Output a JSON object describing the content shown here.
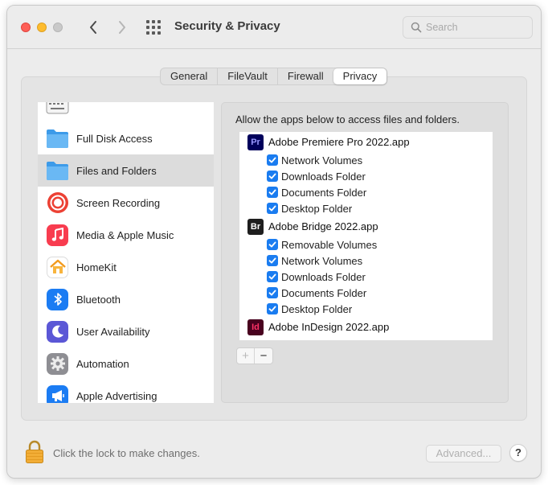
{
  "window": {
    "title": "Security & Privacy",
    "search": {
      "placeholder": "Search",
      "value": ""
    }
  },
  "tabs": [
    {
      "label": "General",
      "active": false
    },
    {
      "label": "FileVault",
      "active": false
    },
    {
      "label": "Firewall",
      "active": false
    },
    {
      "label": "Privacy",
      "active": true
    }
  ],
  "sidebar": {
    "items": [
      {
        "label": "",
        "icon": "keyboard-icon"
      },
      {
        "label": "Full Disk Access",
        "icon": "folder-icon"
      },
      {
        "label": "Files and Folders",
        "icon": "folder-icon",
        "selected": true
      },
      {
        "label": "Screen Recording",
        "icon": "screen-recording-icon"
      },
      {
        "label": "Media & Apple Music",
        "icon": "music-note-icon"
      },
      {
        "label": "HomeKit",
        "icon": "home-icon"
      },
      {
        "label": "Bluetooth",
        "icon": "bluetooth-icon"
      },
      {
        "label": "User Availability",
        "icon": "moon-icon"
      },
      {
        "label": "Automation",
        "icon": "gear-icon"
      },
      {
        "label": "Apple Advertising",
        "icon": "megaphone-icon"
      }
    ]
  },
  "panel": {
    "header": "Allow the apps below to access files and folders.",
    "apps": [
      {
        "name": "Adobe Premiere Pro 2022.app",
        "badge": "Pr",
        "badge_bg": "#00005b",
        "badge_fg": "#9999ff",
        "permissions": [
          {
            "label": "Network Volumes",
            "checked": true
          },
          {
            "label": "Downloads Folder",
            "checked": true
          },
          {
            "label": "Documents Folder",
            "checked": true
          },
          {
            "label": "Desktop Folder",
            "checked": true
          }
        ]
      },
      {
        "name": "Adobe Bridge 2022.app",
        "badge": "Br",
        "badge_bg": "#1e1e1e",
        "badge_fg": "#ffffff",
        "permissions": [
          {
            "label": "Removable Volumes",
            "checked": true
          },
          {
            "label": "Network Volumes",
            "checked": true
          },
          {
            "label": "Downloads Folder",
            "checked": true
          },
          {
            "label": "Documents Folder",
            "checked": true
          },
          {
            "label": "Desktop Folder",
            "checked": true
          }
        ]
      },
      {
        "name": "Adobe InDesign 2022.app",
        "badge": "Id",
        "badge_bg": "#49021f",
        "badge_fg": "#ff3366",
        "permissions": []
      }
    ],
    "add_label": "+",
    "remove_label": "−"
  },
  "footer": {
    "lock_text": "Click the lock to make changes.",
    "advanced_label": "Advanced...",
    "help_label": "?"
  },
  "colors": {
    "accent": "#1a7cf0",
    "window_bg": "#ececec",
    "selection_bg": "#dcdcdc"
  }
}
